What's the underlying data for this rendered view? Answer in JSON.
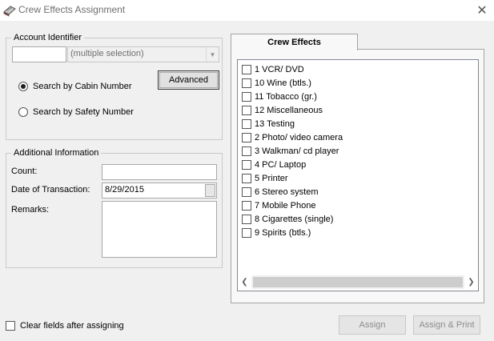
{
  "window": {
    "title": "Crew Effects Assignment",
    "close_glyph": "✕"
  },
  "account_group": {
    "legend": "Account Identifier",
    "account_value": "",
    "selection_placeholder": "(multiple selection)",
    "radio_cabin": "Search by Cabin Number",
    "radio_safety": "Search by Safety Number",
    "selected_radio": "cabin",
    "advanced_label": "Advanced"
  },
  "info_group": {
    "legend": "Additional Information",
    "count_label": "Count:",
    "count_value": "",
    "date_label": "Date of Transaction:",
    "date_value": "8/29/2015",
    "remarks_label": "Remarks:",
    "remarks_value": ""
  },
  "effects": {
    "tab_label": "Crew Effects",
    "items": [
      "1 VCR/ DVD",
      "10 Wine (btls.)",
      "11 Tobacco (gr.)",
      "12 Miscellaneous",
      "13 Testing",
      "2 Photo/ video camera",
      "3 Walkman/ cd player",
      "4 PC/ Laptop",
      "5 Printer",
      "6 Stereo system",
      "7 Mobile Phone",
      "8 Cigarettes (single)",
      "9 Spirits (btls.)"
    ]
  },
  "footer": {
    "clear_label": "Clear fields after assigning",
    "assign_label": "Assign",
    "assign_print_label": "Assign & Print"
  },
  "colors": {
    "window_bg": "#f0f0f0",
    "disabled_text": "#8c8c8c",
    "group_border": "#c9c9c9"
  }
}
